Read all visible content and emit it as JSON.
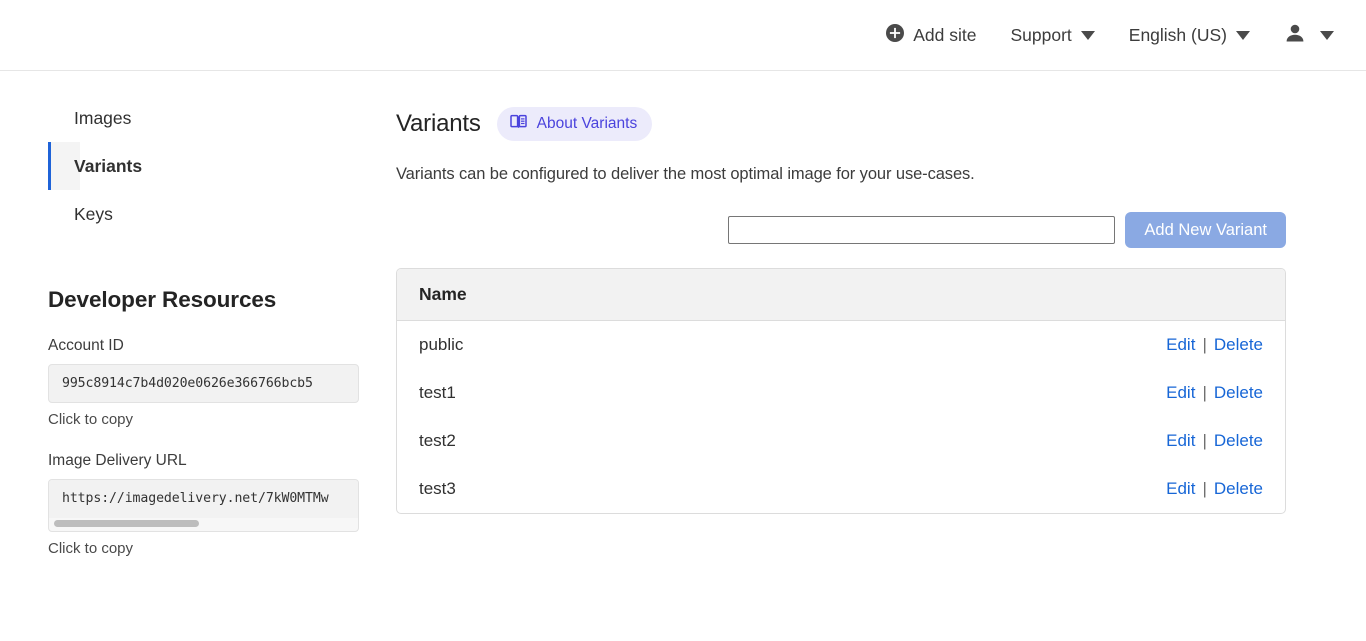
{
  "topbar": {
    "add_site": {
      "label": "Add site",
      "icon": "plus-circle-icon"
    },
    "support": {
      "label": "Support",
      "icon": "chevron-down-icon"
    },
    "language": {
      "label": "English (US)",
      "icon": "chevron-down-icon"
    },
    "user": {
      "icon": "person-icon",
      "caret": "chevron-down-icon"
    }
  },
  "sidebar": {
    "items": [
      {
        "label": "Images",
        "active": false
      },
      {
        "label": "Variants",
        "active": true
      },
      {
        "label": "Keys",
        "active": false
      }
    ],
    "dev_resources": {
      "title": "Developer Resources",
      "account_id": {
        "label": "Account ID",
        "value": "995c8914c7b4d020e0626e366766bcb5",
        "hint": "Click to copy"
      },
      "image_delivery_url": {
        "label": "Image Delivery URL",
        "value": "https://imagedelivery.net/7kW0MTMw",
        "hint": "Click to copy"
      }
    }
  },
  "main": {
    "title": "Variants",
    "about_badge": {
      "label": "About Variants",
      "icon": "book-icon"
    },
    "description": "Variants can be configured to deliver the most optimal image for your use-cases.",
    "new_variant_input": {
      "value": "",
      "placeholder": ""
    },
    "add_button": "Add New Variant",
    "table": {
      "columns": [
        "Name"
      ],
      "rows": [
        {
          "name": "public",
          "edit": "Edit",
          "separator": "|",
          "delete": "Delete"
        },
        {
          "name": "test1",
          "edit": "Edit",
          "separator": "|",
          "delete": "Delete"
        },
        {
          "name": "test2",
          "edit": "Edit",
          "separator": "|",
          "delete": "Delete"
        },
        {
          "name": "test3",
          "edit": "Edit",
          "separator": "|",
          "delete": "Delete"
        }
      ]
    }
  },
  "colors": {
    "accent_blue": "#1f63d8",
    "link_blue": "#1766d6",
    "badge_purple": "#4b43dd",
    "badge_bg": "#ecebfb",
    "button_blue": "#8aa9e3"
  }
}
